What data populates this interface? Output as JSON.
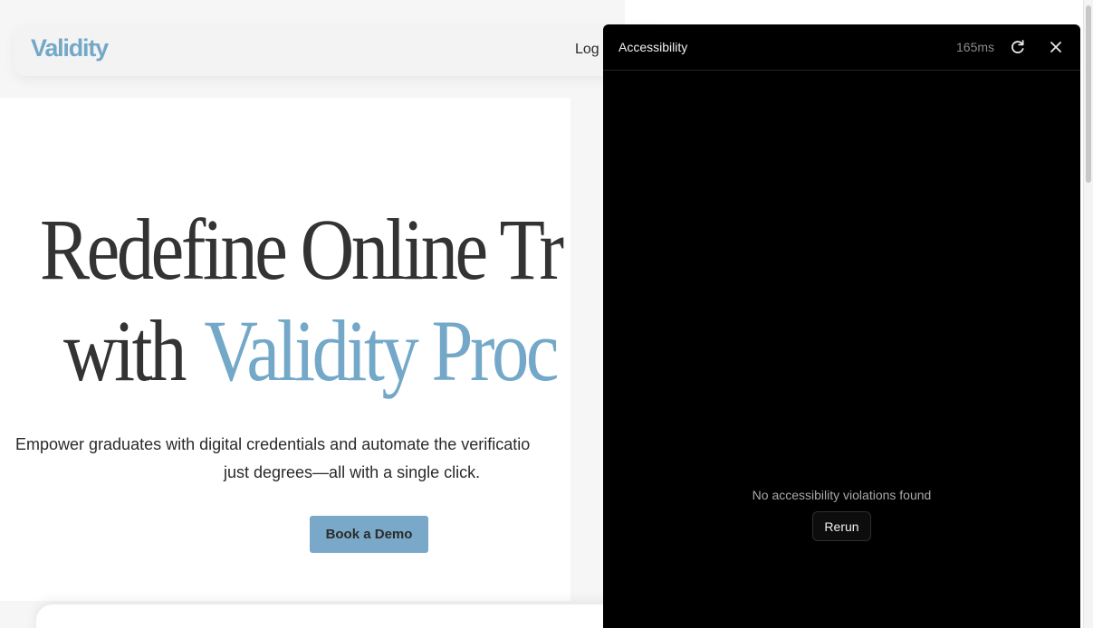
{
  "site": {
    "logo": "Validity",
    "nav_login": "Log",
    "hero": {
      "line1": "Redefine Online Tr",
      "line2_prefix": "with",
      "line2_accent": "Validity Proc"
    },
    "subtitle": {
      "line1": "Empower graduates with digital credentials and automate the verificatio",
      "line2": "just degrees—all with a single click."
    },
    "cta_label": "Book a Demo",
    "colors": {
      "brand": "#74a8c8",
      "heading": "#333333",
      "button": "#7aa8c8"
    }
  },
  "a11y_panel": {
    "title": "Accessibility",
    "timing": "165ms",
    "icons": {
      "refresh": "refresh-icon",
      "close": "close-icon"
    },
    "empty_message": "No accessibility violations found",
    "rerun_label": "Rerun",
    "colors": {
      "background": "#000000",
      "muted_text": "#8a8a8a"
    }
  }
}
